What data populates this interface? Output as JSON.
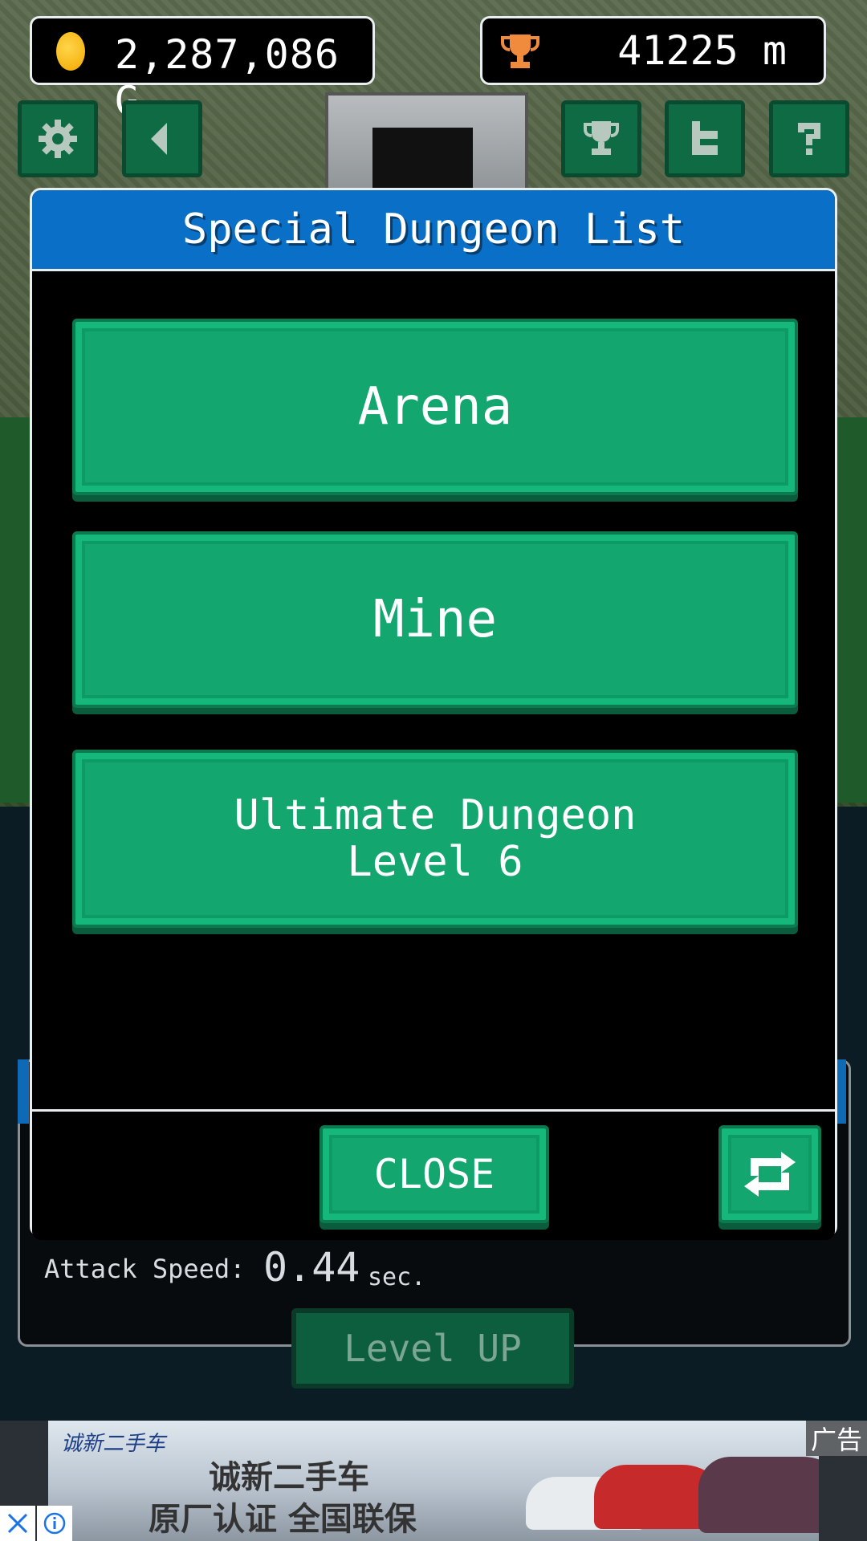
{
  "hud": {
    "gold": "2,287,086",
    "gold_unit": "G",
    "distance": "41225",
    "distance_unit": "m"
  },
  "toolbar": {
    "buttons": [
      "gear-icon",
      "speaker-icon",
      "trophy-icon",
      "twitter-icon",
      "help-icon"
    ]
  },
  "modal": {
    "title": "Special Dungeon List",
    "items": [
      {
        "line1": "Arena",
        "line2": ""
      },
      {
        "line1": "Mine",
        "line2": ""
      },
      {
        "line1": "Ultimate Dungeon",
        "line2": "Level 6"
      }
    ],
    "close_label": "CLOSE"
  },
  "stats": {
    "attack_speed_label": "Attack Speed:",
    "attack_speed_value": "0.44",
    "attack_speed_unit": "sec.",
    "level_up_label": "Level UP"
  },
  "ad": {
    "brand": "诚新二手车",
    "line1": "诚新二手车",
    "line2": "原厂认证 全国联保",
    "tag": "广告"
  },
  "colors": {
    "accent_green": "#13a66f",
    "header_blue": "#0a6fc6",
    "trophy_orange": "#f08a3c"
  }
}
